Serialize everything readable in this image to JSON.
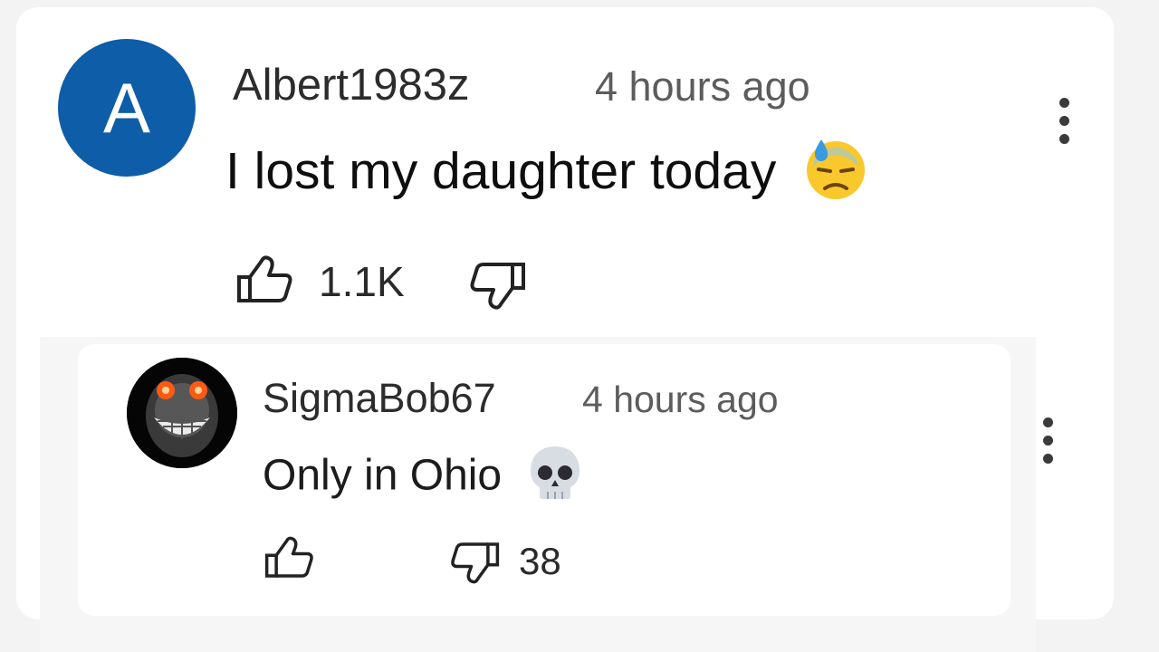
{
  "comments": [
    {
      "username": "Albert1983z",
      "timestamp": "4 hours ago",
      "avatar_letter": "A",
      "avatar_color": "#0d5da8",
      "text": "I lost my daughter today",
      "emoji": "downcast-face-with-sweat",
      "likes": "1.1K",
      "icons": [
        "thumbs-up-icon",
        "thumbs-down-icon",
        "more-vert-icon"
      ]
    },
    {
      "username": "SigmaBob67",
      "timestamp": "4 hours ago",
      "avatar": "grinning-troll-face",
      "text": "Only in Ohio",
      "emoji": "skull",
      "dislikes": "38",
      "icons": [
        "thumbs-up-icon",
        "thumbs-down-icon",
        "more-vert-icon"
      ]
    }
  ]
}
